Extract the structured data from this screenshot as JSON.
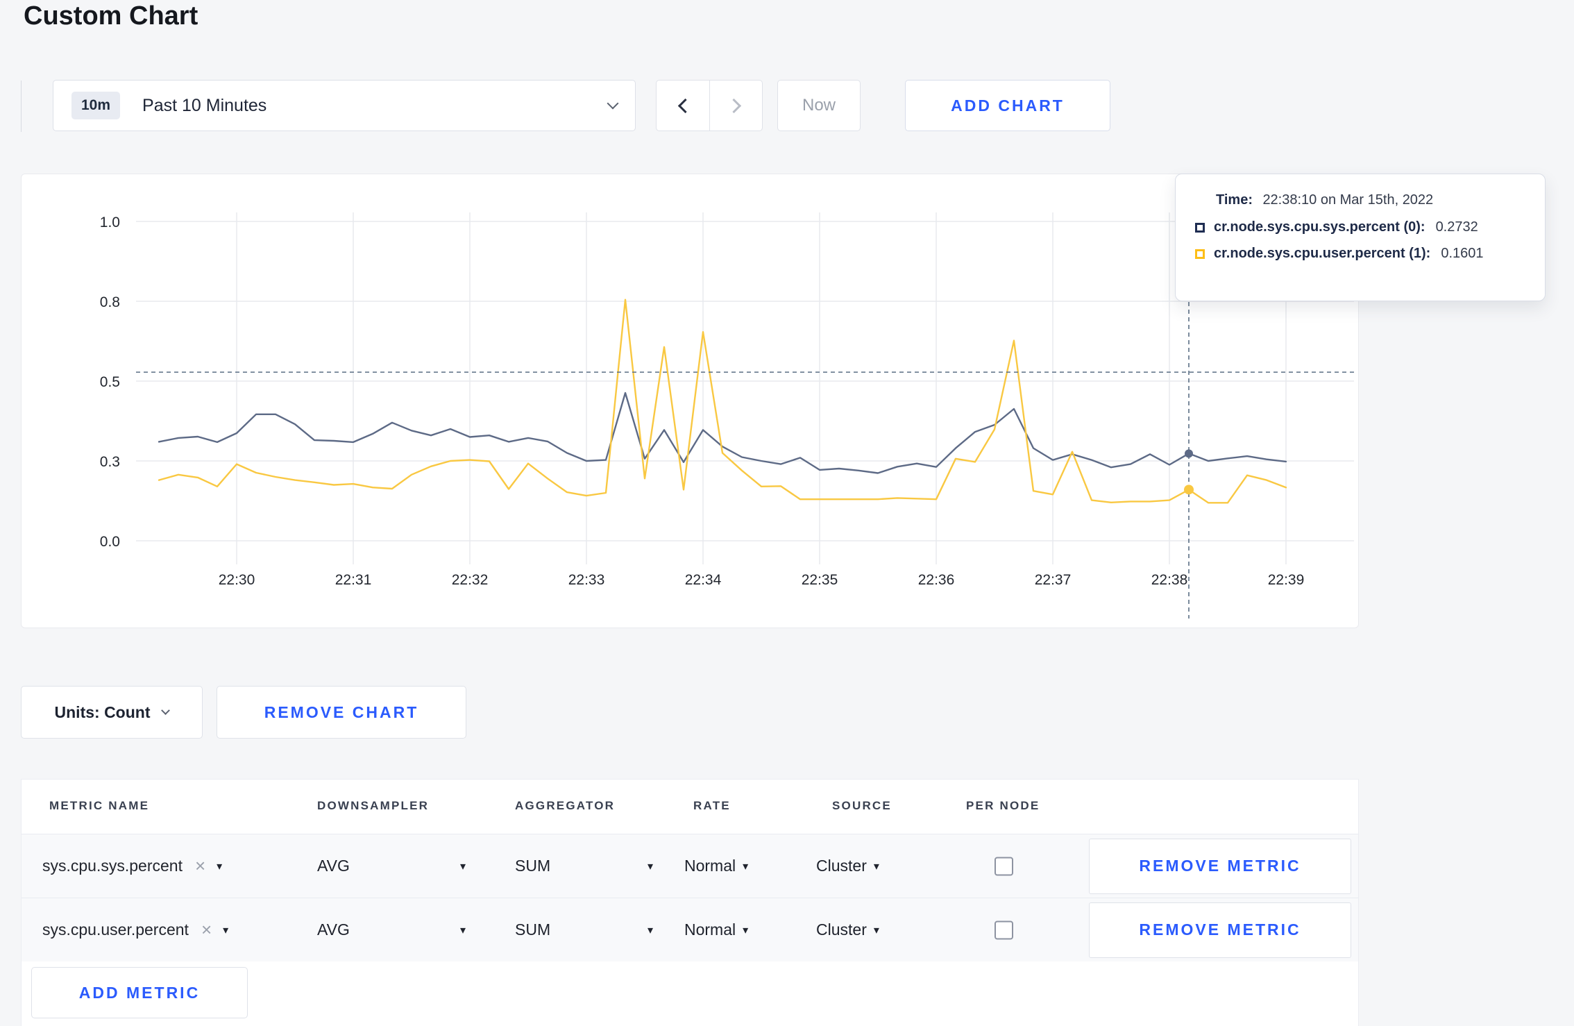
{
  "page": {
    "title": "Custom Chart",
    "background": "#f5f6f8",
    "accent_blue": "#2b5bfd"
  },
  "toolbar": {
    "time_selector": {
      "badge": "10m",
      "label": "Past 10 Minutes"
    },
    "now_label": "Now",
    "add_chart_label": "ADD CHART"
  },
  "chart_data": {
    "type": "line",
    "title": "",
    "xlabel": "",
    "ylabel": "",
    "ylim": [
      0,
      1
    ],
    "grid": true,
    "legend_position": "tooltip-only",
    "y_ticks": [
      {
        "v": 0,
        "label": "0.0"
      },
      {
        "v": 0.25,
        "label": "0.3"
      },
      {
        "v": 0.5,
        "label": "0.5"
      },
      {
        "v": 0.75,
        "label": "0.8"
      },
      {
        "v": 1,
        "label": "1.0"
      }
    ],
    "x_ticks": [
      {
        "t": 30,
        "label": "22:30"
      },
      {
        "t": 31,
        "label": "22:31"
      },
      {
        "t": 32,
        "label": "22:32"
      },
      {
        "t": 33,
        "label": "22:33"
      },
      {
        "t": 34,
        "label": "22:34"
      },
      {
        "t": 35,
        "label": "22:35"
      },
      {
        "t": 36,
        "label": "22:36"
      },
      {
        "t": 37,
        "label": "22:37"
      },
      {
        "t": 38,
        "label": "22:38"
      },
      {
        "t": 39,
        "label": "22:39"
      }
    ],
    "start_time": "22:29:20",
    "interval_seconds": 10,
    "series": [
      {
        "name": "cr.node.sys.cpu.sys.percent",
        "color": "#5d6a86",
        "values": [
          0.31,
          0.322,
          0.326,
          0.309,
          0.337,
          0.396,
          0.396,
          0.365,
          0.315,
          0.313,
          0.309,
          0.335,
          0.37,
          0.345,
          0.33,
          0.35,
          0.325,
          0.33,
          0.31,
          0.322,
          0.311,
          0.275,
          0.25,
          0.253,
          0.463,
          0.257,
          0.347,
          0.246,
          0.347,
          0.295,
          0.262,
          0.25,
          0.24,
          0.26,
          0.222,
          0.226,
          0.22,
          0.212,
          0.232,
          0.242,
          0.231,
          0.29,
          0.341,
          0.363,
          0.413,
          0.29,
          0.253,
          0.271,
          0.253,
          0.23,
          0.24,
          0.271,
          0.238,
          0.2732,
          0.25,
          0.258,
          0.265,
          0.255,
          0.248
        ]
      },
      {
        "name": "cr.node.sys.cpu.user.percent",
        "color": "#f9c842",
        "values": [
          0.19,
          0.207,
          0.198,
          0.17,
          0.24,
          0.213,
          0.2,
          0.19,
          0.183,
          0.175,
          0.178,
          0.167,
          0.163,
          0.207,
          0.233,
          0.25,
          0.253,
          0.249,
          0.162,
          0.242,
          0.195,
          0.152,
          0.141,
          0.15,
          0.755,
          0.195,
          0.607,
          0.16,
          0.654,
          0.275,
          0.22,
          0.17,
          0.171,
          0.13,
          0.13,
          0.13,
          0.13,
          0.13,
          0.134,
          0.132,
          0.13,
          0.257,
          0.247,
          0.349,
          0.627,
          0.156,
          0.145,
          0.279,
          0.127,
          0.12,
          0.123,
          0.123,
          0.127,
          0.1601,
          0.119,
          0.119,
          0.205,
          0.19,
          0.167
        ]
      }
    ],
    "crosshair": {
      "t": 38.1667,
      "h_value": 0.528,
      "marker_values": [
        0.2732,
        0.1601
      ]
    }
  },
  "tooltip": {
    "time_label": "Time:",
    "time_value": "22:38:10 on Mar 15th, 2022",
    "rows": [
      {
        "label": "cr.node.sys.cpu.sys.percent (0):",
        "value": "0.2732",
        "color": "#1f2d52"
      },
      {
        "label": "cr.node.sys.cpu.user.percent (1):",
        "value": "0.1601",
        "color": "#fdbe17"
      }
    ]
  },
  "chart_footer": {
    "units_label": "Units: Count",
    "remove_chart_label": "REMOVE CHART"
  },
  "metrics_table": {
    "headers": [
      "METRIC NAME",
      "DOWNSAMPLER",
      "AGGREGATOR",
      "RATE",
      "SOURCE",
      "PER NODE"
    ],
    "rows": [
      {
        "metric": "sys.cpu.sys.percent",
        "downsampler": "AVG",
        "aggregator": "SUM",
        "rate": "Normal",
        "source": "Cluster",
        "per_node_checked": false
      },
      {
        "metric": "sys.cpu.user.percent",
        "downsampler": "AVG",
        "aggregator": "SUM",
        "rate": "Normal",
        "source": "Cluster",
        "per_node_checked": false
      }
    ],
    "remove_metric_label": "REMOVE METRIC",
    "add_metric_label": "ADD METRIC"
  },
  "icons": {
    "close": "×",
    "caret_down": "▾"
  }
}
